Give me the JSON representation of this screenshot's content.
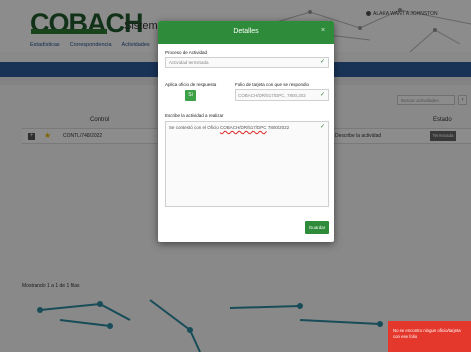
{
  "header": {
    "logo_text": "COBACH",
    "app_title": "Sistema Integral",
    "user_text": "ALAKA WANT A JOHNSTON"
  },
  "nav": {
    "items": [
      {
        "label": "Estadísticas"
      },
      {
        "label": "Correspondencia"
      },
      {
        "label": "Actividades"
      }
    ]
  },
  "table": {
    "search_placeholder": "Buscar actividades",
    "scroll_label": "‹",
    "col_control": "Control",
    "col_estado": "Estado",
    "row": {
      "expand_label": "+",
      "star_label": "★",
      "control": "CONTL/748/2022",
      "activity_label": "Describe la actividad",
      "status": "Terminada"
    },
    "footer": "Mostrando 1 a 1 de 1 filas"
  },
  "modal": {
    "title": "Detalles",
    "close_label": "×",
    "proceso_label": "Proceso de Actividad",
    "proceso_value": "Actividad terminada",
    "aplica_label": "Aplica oficio de respuesta",
    "toggle_label": "Si",
    "folio_label": "Folio de tarjeta con que se respondio",
    "folio_value": "COBACH/DR/517/DPC, 7800,202",
    "describe_label": "Escribe la actividad a realizar",
    "describe_value_prefix": "Se contestó con el Oficio ",
    "describe_value_link": "COBACH/DR/517/DPC",
    "describe_value_suffix": "7800/2022",
    "check_mark": "✓",
    "save_label": "Guardar"
  },
  "toast": {
    "message": "No se encontro ningun oficio/tarjeta con ese folio"
  },
  "colors": {
    "brand_green": "#2e8b3a",
    "nav_blue": "#2f5e9e",
    "toast_red": "#e5382c"
  }
}
